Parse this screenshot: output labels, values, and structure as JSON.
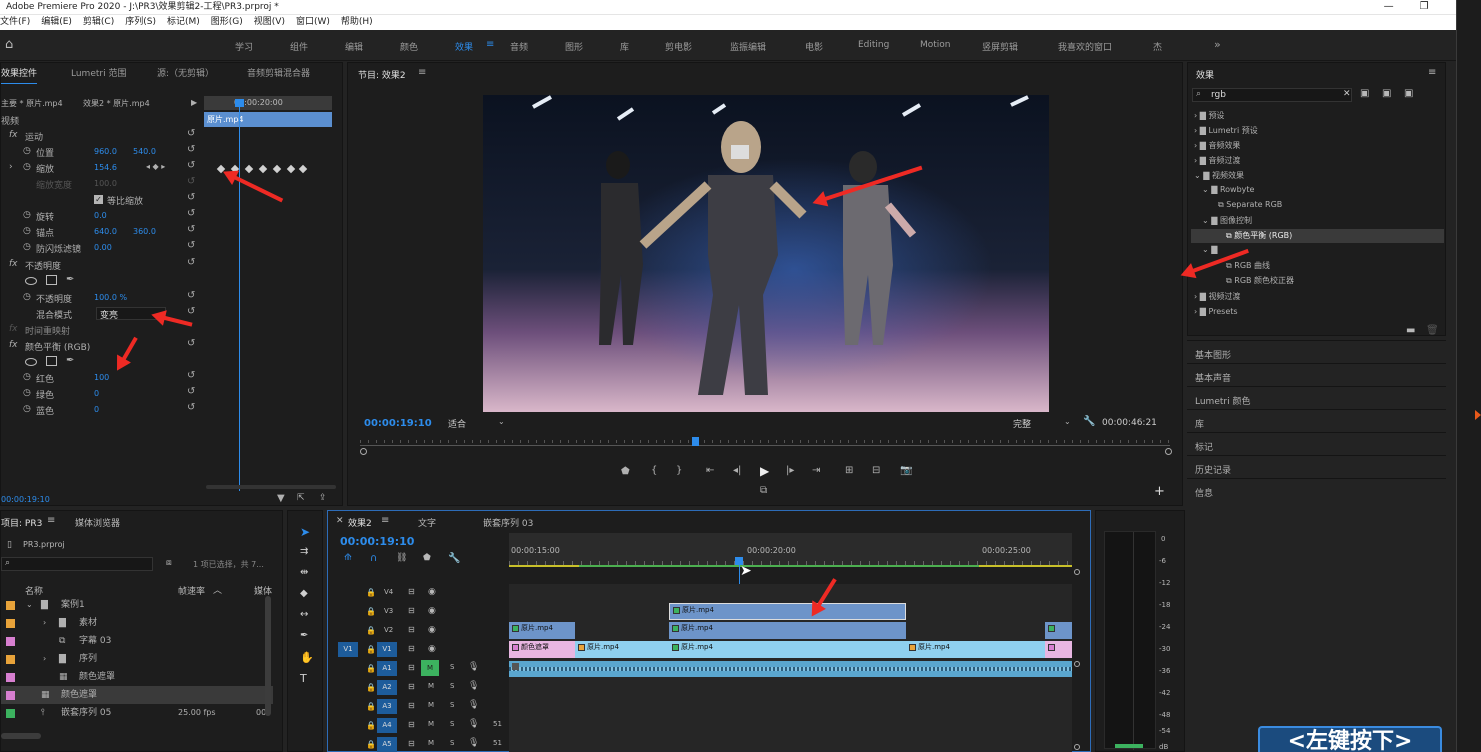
{
  "window": {
    "title": "Adobe Premiere Pro 2020 - J:\\PR3\\效果剪辑2-工程\\PR3.prproj *",
    "min": "—",
    "max": "❐",
    "close": "✕"
  },
  "menu": [
    "文件(F)",
    "编辑(E)",
    "剪辑(C)",
    "序列(S)",
    "标记(M)",
    "图形(G)",
    "视图(V)",
    "窗口(W)",
    "帮助(H)"
  ],
  "workspaces": [
    "学习",
    "组件",
    "编辑",
    "颜色",
    "效果",
    "音频",
    "图形",
    "库",
    "剪电影",
    "监振编辑",
    "电影",
    "Editing",
    "Motion",
    "竖屏剪辑",
    "我喜欢的窗口",
    "杰"
  ],
  "workspace_more": "»",
  "effect_controls": {
    "tabs": [
      "效果控件",
      "Lumetri 范围",
      "源:（无剪辑）",
      "音频剪辑混合器"
    ],
    "master": "主要 * 原片.mp4",
    "sequence_clip": "效果2 * 原片.mp4",
    "timecode_top": "00:00:20:00",
    "clip_label": "原片.mp4",
    "video_label": "视频",
    "motion": "运动",
    "position": "位置",
    "position_x": "960.0",
    "position_y": "540.0",
    "scale": "缩放",
    "scale_val": "154.6",
    "scale_width": "缩放宽度",
    "scale_width_val": "100.0",
    "uniform_scale": "等比缩放",
    "rotation": "旋转",
    "rotation_val": "0.0",
    "anchor": "锚点",
    "anchor_x": "640.0",
    "anchor_y": "360.0",
    "antiflicker": "防闪烁滤镜",
    "antiflicker_val": "0.00",
    "opacity_group": "不透明度",
    "opacity": "不透明度",
    "opacity_val": "100.0 %",
    "blend_mode": "混合模式",
    "blend_val": "变亮",
    "time_remap": "时间重映射",
    "color_balance": "颜色平衡 (RGB)",
    "red": "红色",
    "red_val": "100",
    "green": "绿色",
    "green_val": "0",
    "blue": "蓝色",
    "blue_val": "0",
    "current_time": "00:00:19:10"
  },
  "program": {
    "title": "节目: 效果2",
    "timecode": "00:00:19:10",
    "fit": "适合",
    "quality": "完整",
    "duration": "00:00:46:21"
  },
  "effects_panel": {
    "title": "效果",
    "search": "rgb",
    "items": [
      {
        "label": "预设",
        "indent": 0
      },
      {
        "label": "Lumetri 预设",
        "indent": 0
      },
      {
        "label": "音频效果",
        "indent": 0
      },
      {
        "label": "音频过渡",
        "indent": 0
      },
      {
        "label": "视频效果",
        "indent": 0
      },
      {
        "label": "Rowbyte",
        "indent": 1
      },
      {
        "label": "Separate RGB",
        "indent": 2
      },
      {
        "label": "图像控制",
        "indent": 1
      },
      {
        "label": "颜色平衡 (RGB)",
        "indent": 2,
        "selected": true
      },
      {
        "label": "",
        "indent": 1
      },
      {
        "label": "RGB 曲线",
        "indent": 2
      },
      {
        "label": "RGB 颜色校正器",
        "indent": 2
      },
      {
        "label": "视频过渡",
        "indent": 0
      },
      {
        "label": "Presets",
        "indent": 0
      }
    ],
    "side_panels": [
      "基本图形",
      "基本声音",
      "Lumetri 颜色",
      "库",
      "标记",
      "历史记录",
      "信息"
    ]
  },
  "project": {
    "tabs": [
      "项目: PR3",
      "媒体浏览器"
    ],
    "file": "PR3.prproj",
    "selection": "1 项已选择，共 7...",
    "col_name": "名称",
    "col_fps": "帧速率",
    "col_media": "媒体",
    "rows": [
      {
        "name": "案例1",
        "color": "#e8a33a",
        "fps": ""
      },
      {
        "name": "素材",
        "color": "#e8a33a",
        "fps": ""
      },
      {
        "name": "字幕 03",
        "color": "#d77fd0",
        "fps": ""
      },
      {
        "name": "序列",
        "color": "#e8a33a",
        "fps": ""
      },
      {
        "name": "颜色遮罩",
        "color": "#d77fd0",
        "fps": ""
      },
      {
        "name": "颜色遮罩",
        "color": "#d77fd0",
        "fps": "",
        "selected": true
      },
      {
        "name": "嵌套序列 05",
        "color": "#3cb25f",
        "fps": "25.00 fps"
      }
    ],
    "tail": "00"
  },
  "timeline": {
    "tabs": [
      "效果2",
      "文字",
      "嵌套序列 03"
    ],
    "timecode": "00:00:19:10",
    "ruler": [
      "00:00:15:00",
      "00:00:20:00",
      "00:00:25:00"
    ],
    "tracks": [
      "V4",
      "V3",
      "V2",
      "V1",
      "A1",
      "A2",
      "A3",
      "A4",
      "A5"
    ],
    "clips": {
      "v3": "原片.mp4",
      "v2a": "原片.mp4",
      "v2b": "原片.mp4",
      "v1a": "颜色遮罩",
      "v1b": "原片.mp4",
      "v1c": "原片.mp4",
      "v1d": "原片.mp4"
    },
    "audio_marks": [
      "51",
      "51"
    ]
  },
  "meter_labels": [
    "0",
    "-6",
    "-12",
    "-18",
    "-24",
    "-30",
    "-36",
    "-42",
    "-48",
    "-54",
    "dB"
  ],
  "overlay_text": "<左键按下>"
}
